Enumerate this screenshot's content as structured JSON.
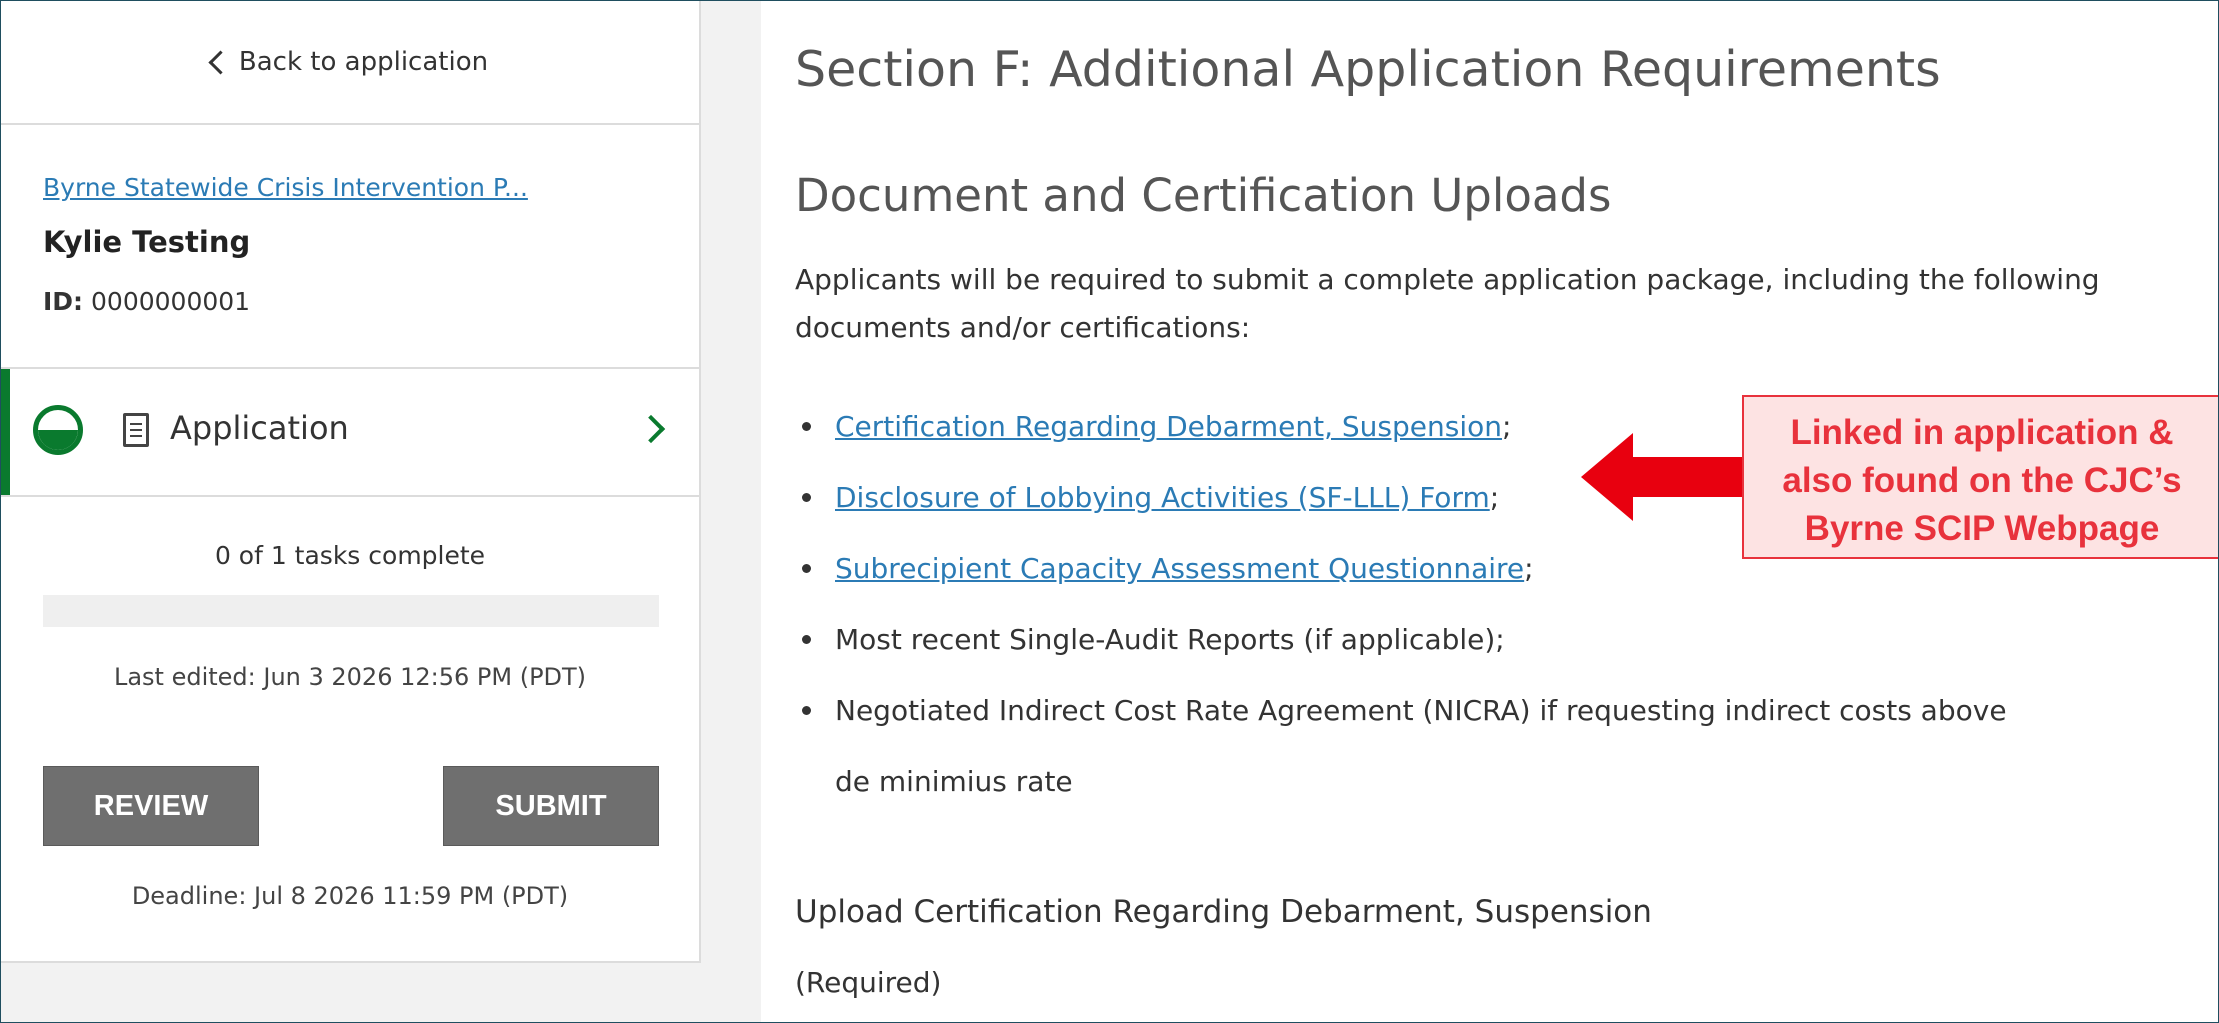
{
  "sidebar": {
    "back_label": "Back to application",
    "grant_link": "Byrne Statewide Crisis Intervention P...",
    "owner": "Kylie Testing",
    "id_label": "ID:",
    "id_value": "0000000001",
    "nav_item_label": "Application",
    "tasks_text": "0 of 1 tasks complete",
    "progress_fraction": 0,
    "last_edited": "Last edited: Jun 3 2026 12:56 PM (PDT)",
    "review_label": "REVIEW",
    "submit_label": "SUBMIT",
    "deadline": "Deadline: Jul 8 2026 11:59 PM (PDT)"
  },
  "main": {
    "section_title": "Section F: Additional Application Requirements",
    "subsection_title": "Document and Certification Uploads",
    "intro": "Applicants will be required to submit a complete application package, including the following documents and/or certifications:",
    "documents": [
      {
        "link": "Certification Regarding Debarment, Suspension",
        "suffix": ";"
      },
      {
        "link": "Disclosure of Lobbying Activities (SF-LLL) Form",
        "suffix": ";"
      },
      {
        "link": "Subrecipient Capacity Assessment Questionnaire",
        "suffix": ";"
      },
      {
        "text": "Most recent Single-Audit Reports (if applicable);"
      },
      {
        "text": "Negotiated Indirect Cost Rate Agreement (NICRA) if requesting indirect costs above de minimius rate"
      }
    ],
    "upload_title": "Upload Certification Regarding Debarment, Suspension",
    "required_label": "(Required)"
  },
  "callout": {
    "text": "Linked in application &\nalso found on the CJC’s\nByrne SCIP Webpage",
    "color": "#e8323c",
    "fill": "#fde3e3"
  },
  "colors": {
    "accent_green": "#0a7a2e",
    "link_blue": "#2b7bb5",
    "button_gray": "#6f6f6f"
  }
}
